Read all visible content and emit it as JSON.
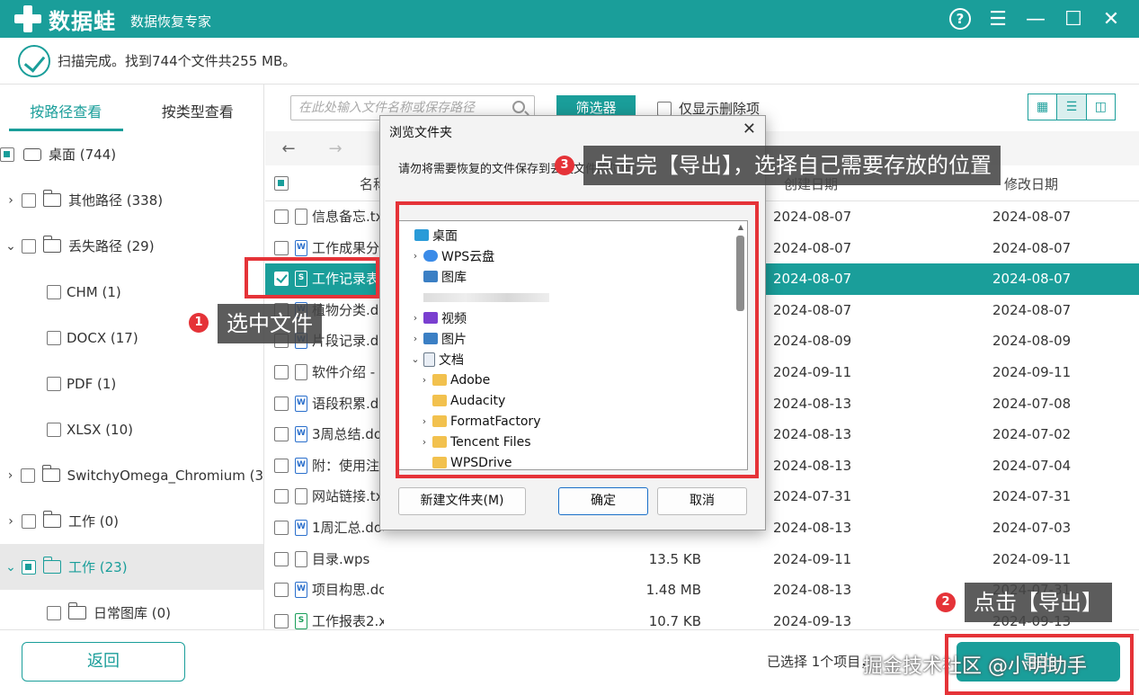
{
  "app": {
    "name": "数据蛙",
    "subtitle": "数据恢复专家",
    "controls": {
      "help": "?",
      "menu": "☰",
      "minimize": "—",
      "maximize": "☐",
      "close": "✕"
    }
  },
  "status": {
    "text": "扫描完成。找到744个文件共255 MB。"
  },
  "left_tabs": [
    "按路径查看",
    "按类型查看"
  ],
  "tree": [
    {
      "chevron": "",
      "label": "桌面 (744)",
      "icon": "drive-icon"
    },
    {
      "chevron": "›",
      "label": "其他路径 (338)",
      "icon": "folder-icon"
    },
    {
      "chevron": "⌄",
      "label": "丢失路径 (29)",
      "icon": "folder-icon"
    },
    {
      "chevron": "",
      "label": "CHM (1)",
      "icon": ""
    },
    {
      "chevron": "",
      "label": "DOCX (17)",
      "icon": ""
    },
    {
      "chevron": "",
      "label": "PDF (1)",
      "icon": ""
    },
    {
      "chevron": "",
      "label": "XLSX (10)",
      "icon": ""
    },
    {
      "chevron": "›",
      "label": "SwitchyOmega_Chromium (3",
      "icon": "folder-icon"
    },
    {
      "chevron": "›",
      "label": "工作 (0)",
      "icon": "folder-icon"
    },
    {
      "chevron": "⌄",
      "label": "工作 (23)",
      "icon": "folder-icon"
    },
    {
      "chevron": "",
      "label": "日常图库 (0)",
      "icon": "folder-icon"
    }
  ],
  "toolbar": {
    "search_placeholder": "在此处输入文件名称或保存路径",
    "filter_label": "筛选器",
    "only_deleted_label": "仅显示删除项",
    "view_icons": [
      "▦",
      "☰",
      "◫"
    ]
  },
  "nav": {
    "back": "←",
    "forward": "→"
  },
  "columns": {
    "name": "名称",
    "created": "创建日期",
    "modified": "修改日期"
  },
  "files": [
    {
      "name": "信息备忘.txt",
      "type": "txt",
      "size": "",
      "created": "2024-08-07",
      "modified": "2024-08-07"
    },
    {
      "name": "工作成果分",
      "type": "doc",
      "size": "",
      "created": "2024-08-07",
      "modified": "2024-08-07"
    },
    {
      "name": "工作记录表",
      "type": "xls",
      "size": "",
      "created": "2024-08-07",
      "modified": "2024-08-07"
    },
    {
      "name": "植物分类.d",
      "type": "doc",
      "size": "",
      "created": "2024-08-07",
      "modified": "2024-08-07"
    },
    {
      "name": "片段记录.d",
      "type": "doc",
      "size": "",
      "created": "2024-08-09",
      "modified": "2024-08-09"
    },
    {
      "name": "软件介绍 -",
      "type": "txt",
      "size": "",
      "created": "2024-09-11",
      "modified": "2024-09-11"
    },
    {
      "name": "语段积累.d",
      "type": "doc",
      "size": "",
      "created": "2024-08-13",
      "modified": "2024-07-08"
    },
    {
      "name": "3周总结.doc",
      "type": "doc",
      "size": "",
      "created": "2024-08-13",
      "modified": "2024-07-02"
    },
    {
      "name": "附：使用注",
      "type": "doc",
      "size": "",
      "created": "2024-08-13",
      "modified": "2024-07-04"
    },
    {
      "name": "网站链接.tx",
      "type": "txt",
      "size": "",
      "created": "2024-07-31",
      "modified": "2024-07-31"
    },
    {
      "name": "1周汇总.docx",
      "type": "doc",
      "size": "",
      "created": "2024-08-13",
      "modified": "2024-07-03"
    },
    {
      "name": "目录.wps",
      "type": "txt",
      "size": "13.5 KB",
      "created": "2024-09-11",
      "modified": "2024-09-11"
    },
    {
      "name": "项目构思.docx",
      "type": "doc",
      "size": "1.48 MB",
      "created": "2024-08-13",
      "modified": "2024-07-31"
    },
    {
      "name": "工作报表2.xlsx",
      "type": "xls",
      "size": "10.7 KB",
      "created": "2024-09-13",
      "modified": "2024-09-13"
    }
  ],
  "bottom": {
    "back_label": "返回",
    "selection_info": "已选择 1个项目，",
    "export_label": "导出",
    "watermark": "掘金技术社区 @小明助手"
  },
  "dialog": {
    "title": "浏览文件夹",
    "close": "✕",
    "description": "请勿将需要恢复的文件保存到丢失文件的位置。",
    "items": [
      {
        "label": "桌面",
        "chevron": "",
        "icon": "ic-desk",
        "indent": 0
      },
      {
        "label": "WPS云盘",
        "chevron": "›",
        "icon": "ic-cloud",
        "indent": 1
      },
      {
        "label": "图库",
        "chevron": "",
        "icon": "ic-pic",
        "indent": 1
      },
      {
        "label": "",
        "chevron": "",
        "icon": "",
        "indent": 1
      },
      {
        "label": "视频",
        "chevron": "›",
        "icon": "ic-vid",
        "indent": 1
      },
      {
        "label": "图片",
        "chevron": "›",
        "icon": "ic-pic",
        "indent": 1
      },
      {
        "label": "文档",
        "chevron": "⌄",
        "icon": "ic-doc",
        "indent": 1
      },
      {
        "label": "Adobe",
        "chevron": "›",
        "icon": "ic-folder",
        "indent": 2
      },
      {
        "label": "Audacity",
        "chevron": "",
        "icon": "ic-folder",
        "indent": 2
      },
      {
        "label": "FormatFactory",
        "chevron": "›",
        "icon": "ic-folder",
        "indent": 2
      },
      {
        "label": "Tencent Files",
        "chevron": "›",
        "icon": "ic-folder",
        "indent": 2
      },
      {
        "label": "WPSDrive",
        "chevron": "",
        "icon": "ic-folder",
        "indent": 2
      }
    ],
    "new_folder_label": "新建文件夹(M)",
    "ok_label": "确定",
    "cancel_label": "取消"
  },
  "annotations": {
    "step1": {
      "badge": "1",
      "text": "选中文件"
    },
    "step2": {
      "badge": "2",
      "text": "点击【导出】"
    },
    "step3": {
      "badge": "3",
      "text": "点击完【导出】，选择自己需要存放的位置"
    }
  },
  "colors": {
    "accent": "#1a9e9a",
    "annotation_red": "#e53338"
  }
}
